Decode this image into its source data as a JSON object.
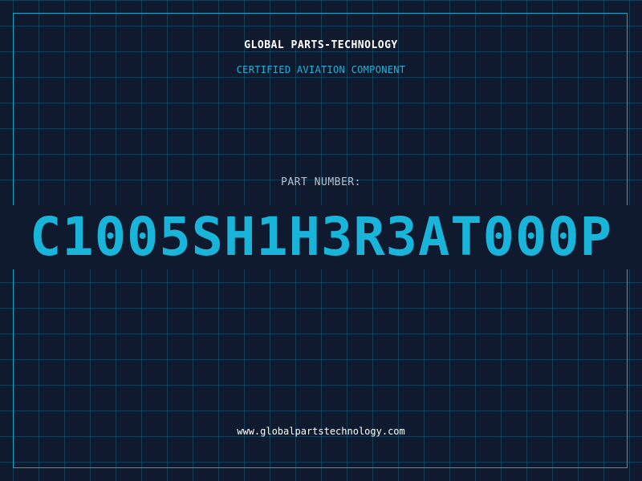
{
  "header": {
    "company": "GLOBAL PARTS-TECHNOLOGY",
    "subtitle": "CERTIFIED AVIATION COMPONENT"
  },
  "part": {
    "label": "PART NUMBER:",
    "number": "C1005SH1H3R3AT000P"
  },
  "footer": {
    "url": "www.globalpartstechnology.com"
  },
  "colors": {
    "background": "#101a2e",
    "grid": "#1a7896",
    "accent": "#19b4d9",
    "text": "#ffffff"
  }
}
